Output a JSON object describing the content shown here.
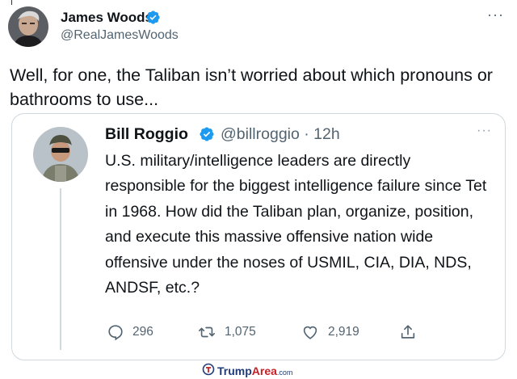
{
  "tweet": {
    "author_name": "James Woods",
    "author_handle": "@RealJamesWoods",
    "text": "Well, for one, the Taliban isn’t worried about which pronouns or bathrooms to use...",
    "more_icon": "more-horizontal-icon"
  },
  "quoted_tweet": {
    "author_name": "Bill Roggio",
    "author_handle": "@billroggio",
    "time": "· 12h",
    "text": "U.S. military/intelligence leaders are directly responsible for the biggest intelligence failure since Tet in 1968. How did the Taliban plan, organize, position, and execute this massive offensive nation wide offensive under the noses of USMIL, CIA, DIA, NDS, ANDSF, etc.?",
    "replies": "296",
    "retweets": "1,075",
    "likes": "2,919"
  },
  "watermark": {
    "brand": "Trump",
    "brand_accent": "Area",
    "suffix": ".com"
  },
  "colors": {
    "verified": "#1d9bf0",
    "secondary_text": "#536471",
    "border": "#cfd9de"
  }
}
